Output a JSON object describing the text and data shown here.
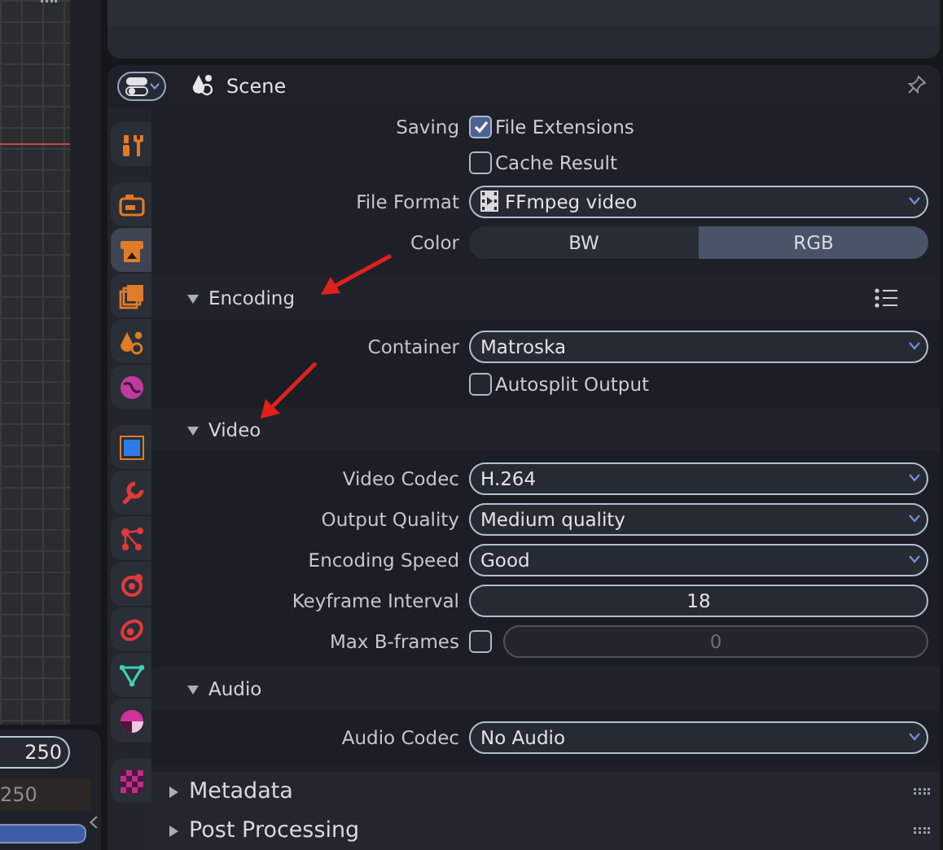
{
  "timeline": {
    "end_frame": "250",
    "current_frame": "250"
  },
  "properties": {
    "context": "Scene",
    "tab_groups": [
      [
        {
          "kind": "tool",
          "selected": false
        }
      ],
      [
        {
          "kind": "render",
          "selected": false
        },
        {
          "kind": "output",
          "selected": true
        },
        {
          "kind": "view_layer",
          "selected": false
        },
        {
          "kind": "scene",
          "selected": false
        },
        {
          "kind": "world",
          "selected": false
        }
      ],
      [
        {
          "kind": "object",
          "selected": false
        },
        {
          "kind": "modifier",
          "selected": false
        },
        {
          "kind": "particles",
          "selected": false
        },
        {
          "kind": "physics",
          "selected": false
        },
        {
          "kind": "constraint",
          "selected": false
        },
        {
          "kind": "data",
          "selected": false
        },
        {
          "kind": "material",
          "selected": false
        }
      ],
      [
        {
          "kind": "texture",
          "selected": false
        }
      ]
    ],
    "output_rows": [
      {
        "kind": "checkbox",
        "label": "Saving",
        "text": "File Extensions",
        "checked": true
      },
      {
        "kind": "checkbox",
        "text": "Cache Result",
        "checked": false
      },
      {
        "kind": "format_dropdown",
        "label": "File Format",
        "value": "FFmpeg video"
      },
      {
        "kind": "segmented",
        "label": "Color",
        "options": [
          {
            "text": "BW",
            "selected": false
          },
          {
            "text": "RGB",
            "selected": true
          }
        ]
      }
    ],
    "panels": [
      {
        "kind": "subpanel",
        "title": "Encoding",
        "expanded": true,
        "presets_menu": true,
        "rows": [
          {
            "kind": "dropdown",
            "label": "Container",
            "value": "Matroska"
          },
          {
            "kind": "checkbox",
            "text": "Autosplit Output",
            "checked": false
          }
        ]
      },
      {
        "kind": "subpanel",
        "title": "Video",
        "expanded": true,
        "rows": [
          {
            "kind": "dropdown",
            "label": "Video Codec",
            "value": "H.264"
          },
          {
            "kind": "dropdown",
            "label": "Output Quality",
            "value": "Medium quality"
          },
          {
            "kind": "dropdown",
            "label": "Encoding Speed",
            "value": "Good"
          },
          {
            "kind": "number",
            "label": "Keyframe Interval",
            "value": "18"
          },
          {
            "kind": "toggle_number",
            "label": "Max B-frames",
            "checked": false,
            "value": "0"
          }
        ]
      },
      {
        "kind": "subpanel",
        "title": "Audio",
        "expanded": true,
        "rows": [
          {
            "kind": "dropdown",
            "label": "Audio Codec",
            "value": "No Audio"
          }
        ]
      },
      {
        "kind": "panel",
        "title": "Metadata",
        "expanded": false
      },
      {
        "kind": "panel",
        "title": "Post Processing",
        "expanded": false
      }
    ]
  }
}
